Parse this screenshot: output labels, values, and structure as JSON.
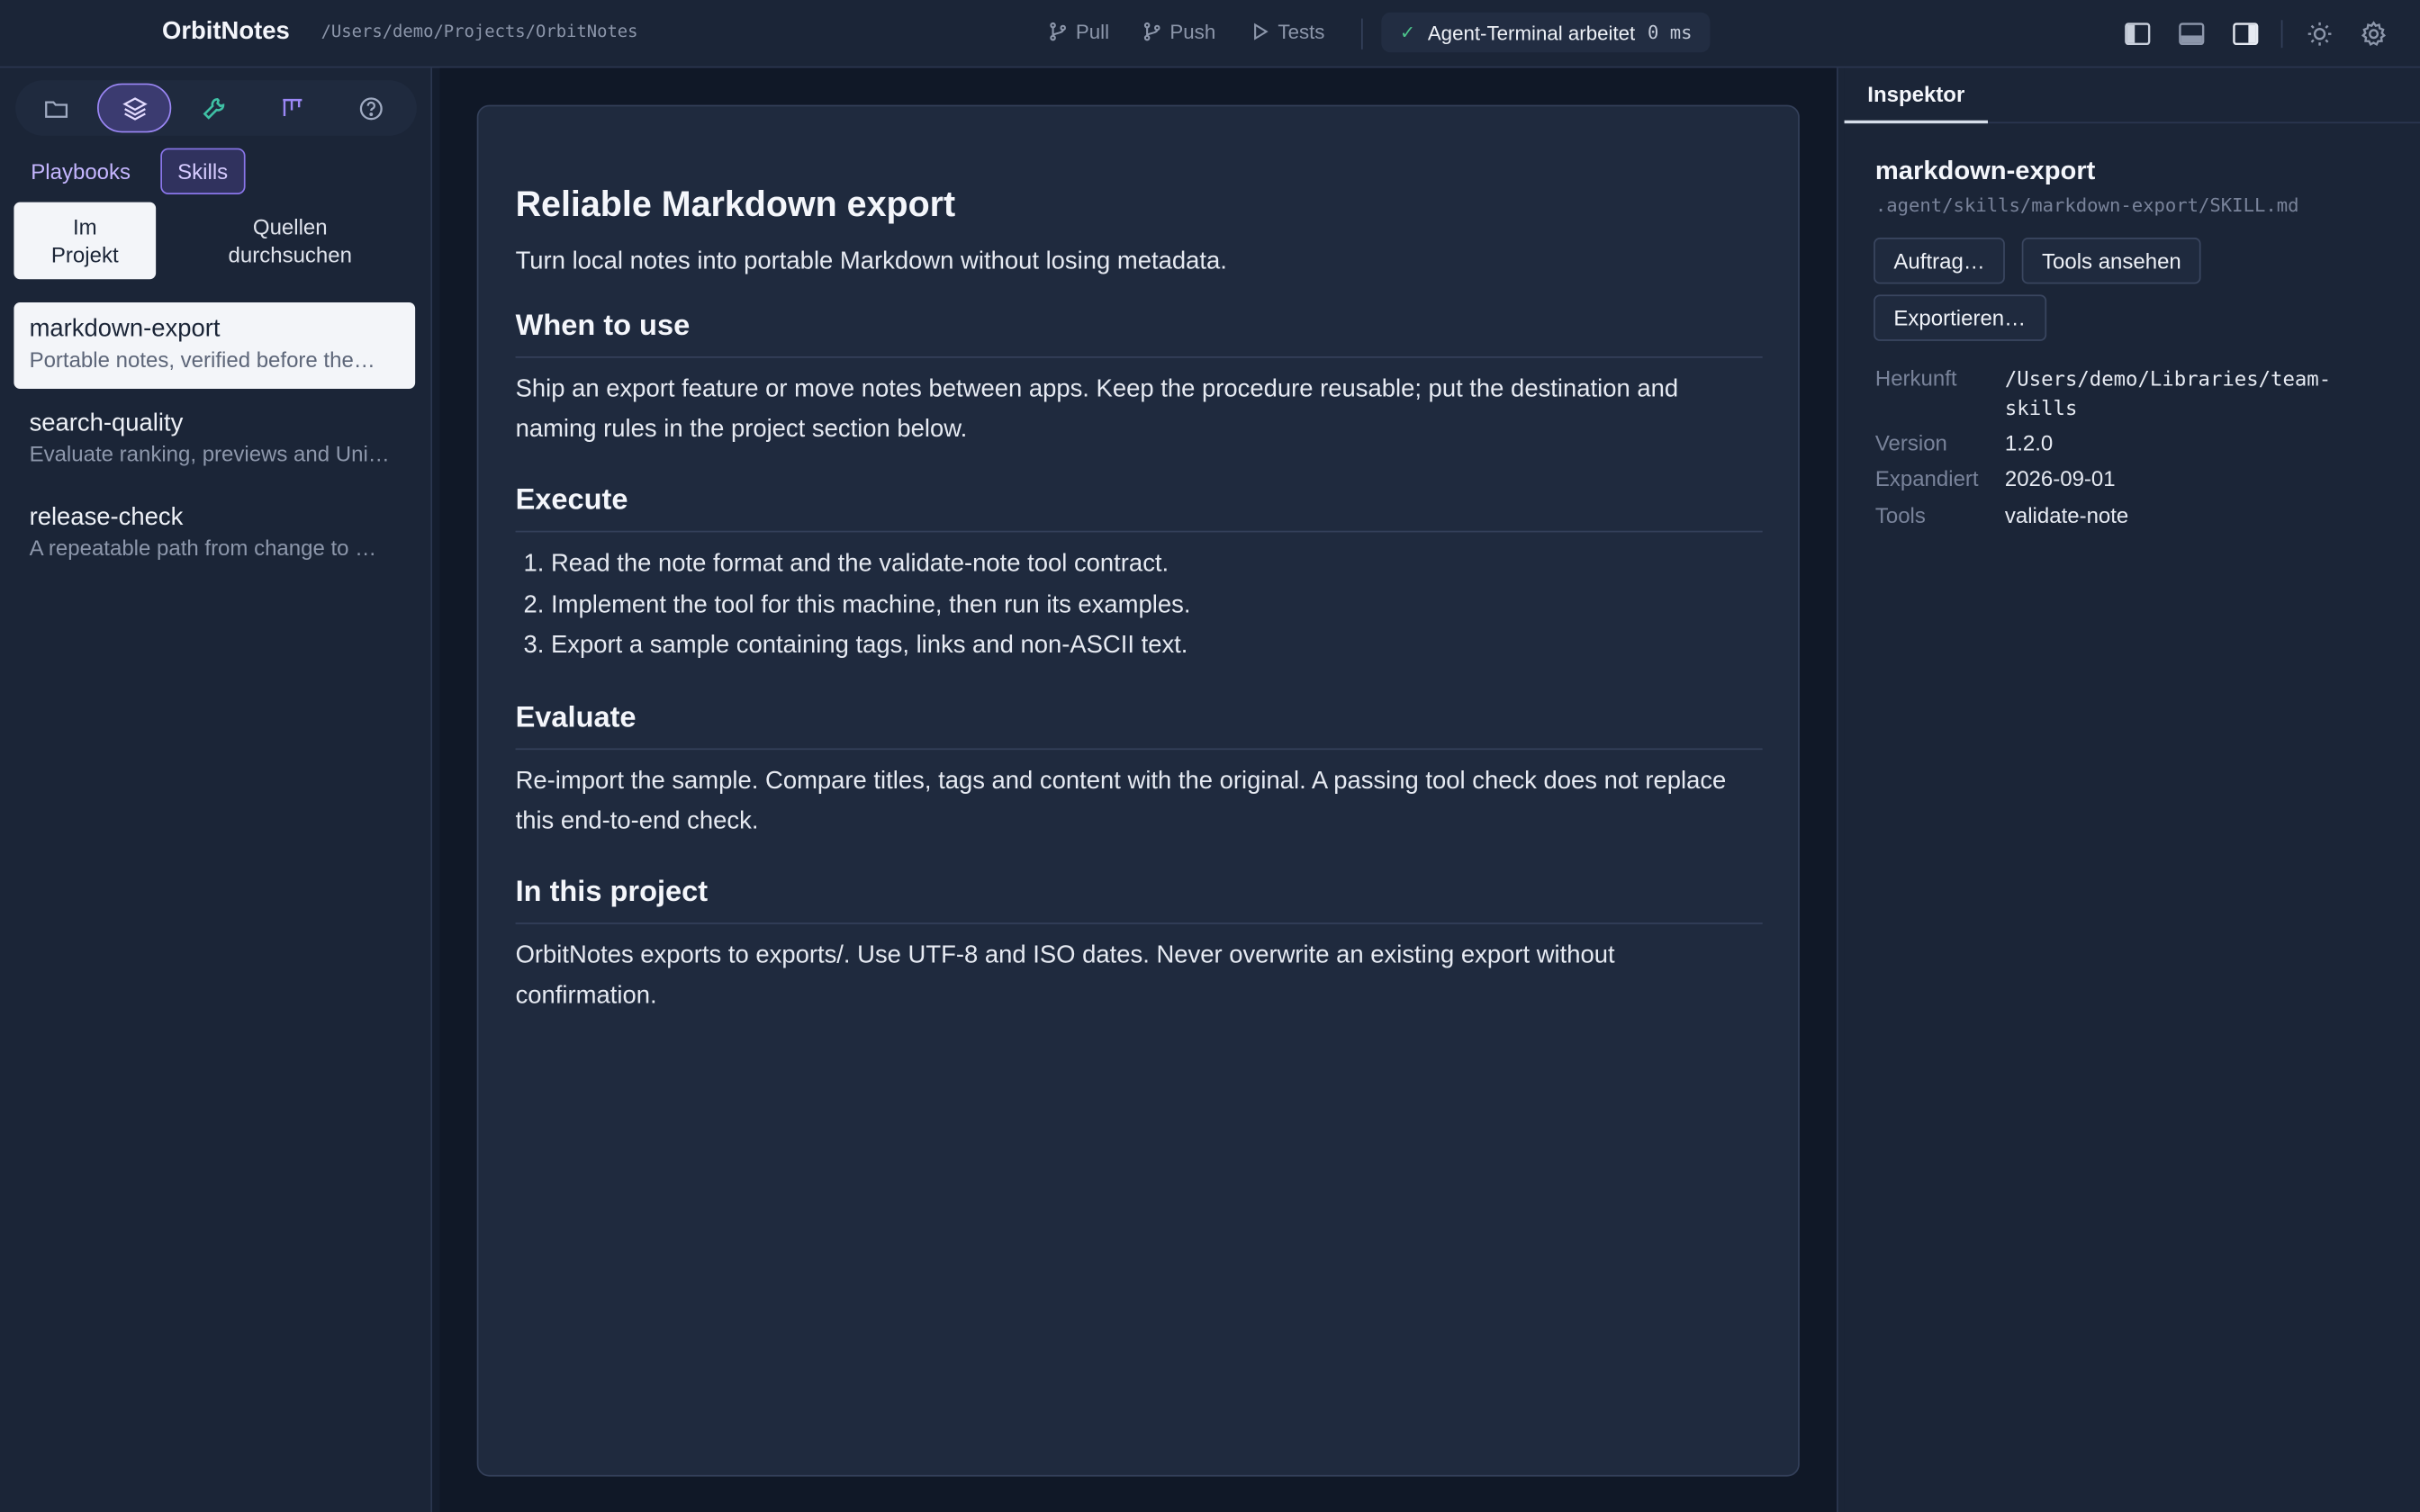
{
  "header": {
    "app_title": "OrbitNotes",
    "project_path": "/Users/demo/Projects/OrbitNotes",
    "actions": {
      "pull": "Pull",
      "push": "Push",
      "tests": "Tests"
    },
    "status": {
      "check": "✓",
      "text": "Agent-Terminal arbeitet",
      "elapsed": "0 ms"
    }
  },
  "sidebar": {
    "rail_icons": [
      "folder-icon",
      "layers-icon",
      "wrench-icon",
      "board-icon",
      "help-icon"
    ],
    "tabs": {
      "playbooks": "Playbooks",
      "skills": "Skills"
    },
    "scope": {
      "active_line1": "Im",
      "active_line2": "Projekt",
      "other_line1": "Quellen",
      "other_line2": "durchsuchen"
    },
    "items": [
      {
        "name": "markdown-export",
        "desc": "Portable notes, verified before the…"
      },
      {
        "name": "search-quality",
        "desc": "Evaluate ranking, previews and Uni…"
      },
      {
        "name": "release-check",
        "desc": "A repeatable path from change to …"
      }
    ]
  },
  "document": {
    "title": "Reliable Markdown export",
    "lead": "Turn local notes into portable Markdown without losing metadata.",
    "sections": {
      "when": {
        "heading": "When to use",
        "body": "Ship an export feature or move notes between apps. Keep the procedure reusable; put the destination and naming rules in the project section below."
      },
      "execute": {
        "heading": "Execute",
        "steps": [
          "Read the note format and the validate-note tool contract.",
          "Implement the tool for this machine, then run its examples.",
          "Export a sample containing tags, links and non-ASCII text."
        ]
      },
      "evaluate": {
        "heading": "Evaluate",
        "body": "Re-import the sample. Compare titles, tags and content with the original. A passing tool check does not replace this end-to-end check."
      },
      "project": {
        "heading": "In this project",
        "body": "OrbitNotes exports to exports/. Use UTF-8 and ISO dates. Never overwrite an existing export without confirmation."
      }
    }
  },
  "inspector": {
    "tab": "Inspektor",
    "title": "markdown-export",
    "path": ".agent/skills/markdown-export/SKILL.md",
    "buttons": {
      "task": "Auftrag…",
      "view_tools": "Tools ansehen",
      "export": "Exportieren…"
    },
    "meta": {
      "origin_label": "Herkunft",
      "origin": "/Users/demo/Libraries/team-skills",
      "version_label": "Version",
      "version": "1.2.0",
      "expanded_label": "Expandiert",
      "expanded": "2026-09-01",
      "tools_label": "Tools",
      "tools": "validate-note"
    }
  },
  "colors": {
    "accent": "#9b87f5",
    "success": "#4cc38a",
    "tool": "#3fc1a5",
    "background": "#1b2537"
  }
}
